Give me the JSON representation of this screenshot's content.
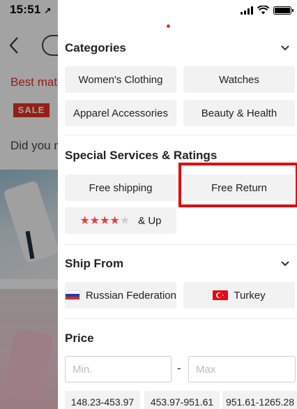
{
  "status_bar": {
    "time": "15:51",
    "location_arrow": "↗"
  },
  "background": {
    "best_match_text": "Best mat",
    "sale_badge": "SALE",
    "did_you_mean_text": "Did you m"
  },
  "drawer": {
    "categories": {
      "title": "Categories",
      "items": [
        "Women's Clothing",
        "Watches",
        "Apparel Accessories",
        "Beauty & Health"
      ]
    },
    "special_services": {
      "title": "Special Services & Ratings",
      "free_shipping": "Free shipping",
      "free_return": "Free Return",
      "rating_filled": "★★★★",
      "rating_empty": "★",
      "rating_label": "& Up",
      "rating_value": 4,
      "rating_max": 5,
      "selected": "Free Return"
    },
    "ship_from": {
      "title": "Ship From",
      "options": [
        "Russian Federation",
        "Turkey"
      ]
    },
    "price": {
      "title": "Price",
      "min_placeholder": "Min.",
      "max_placeholder": "Max",
      "separator": "-",
      "ranges": [
        "148.23-453.97",
        "453.97-951.61",
        "951.61-1265.28"
      ]
    }
  },
  "colors": {
    "accent_red": "#e43225",
    "selection_outline": "#e40000",
    "chip_bg": "#f2f2f2",
    "star_red": "#e43c3c"
  }
}
